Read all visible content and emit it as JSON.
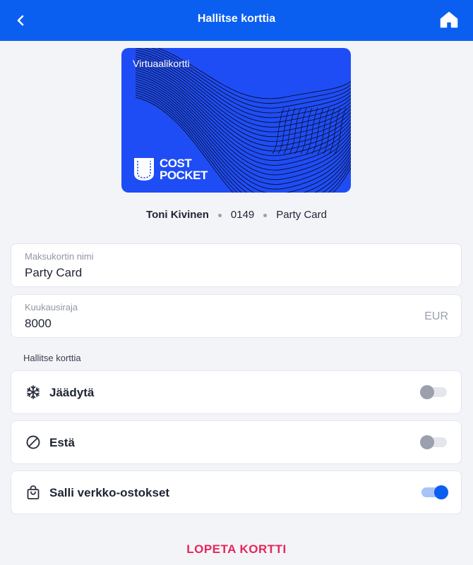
{
  "header": {
    "title": "Hallitse korttia",
    "back_icon": "chevron-left-icon",
    "home_icon": "home-icon"
  },
  "card": {
    "label": "Virtuaalikortti",
    "brand_line1": "COST",
    "brand_line2": "POCKET",
    "color": "#1f4df5"
  },
  "owner": {
    "name": "Toni Kivinen",
    "last_digits": "0149",
    "card_name": "Party Card"
  },
  "fields": {
    "card_name": {
      "label": "Maksukortin nimi",
      "value": "Party Card"
    },
    "monthly_limit": {
      "label": "Kuukausiraja",
      "value": "8000",
      "currency": "EUR"
    }
  },
  "controls": {
    "section_label": "Hallitse korttia",
    "freeze": {
      "label": "Jäädytä",
      "icon": "snowflake-icon",
      "enabled": false
    },
    "block": {
      "label": "Estä",
      "icon": "block-icon",
      "enabled": false
    },
    "online": {
      "label": "Salli verkko-ostokset",
      "icon": "shopping-bag-icon",
      "enabled": true
    }
  },
  "actions": {
    "end_card": "LOPETA KORTTI"
  },
  "colors": {
    "primary": "#0b5ff0",
    "danger": "#e5265a",
    "background": "#f3f4f8"
  }
}
